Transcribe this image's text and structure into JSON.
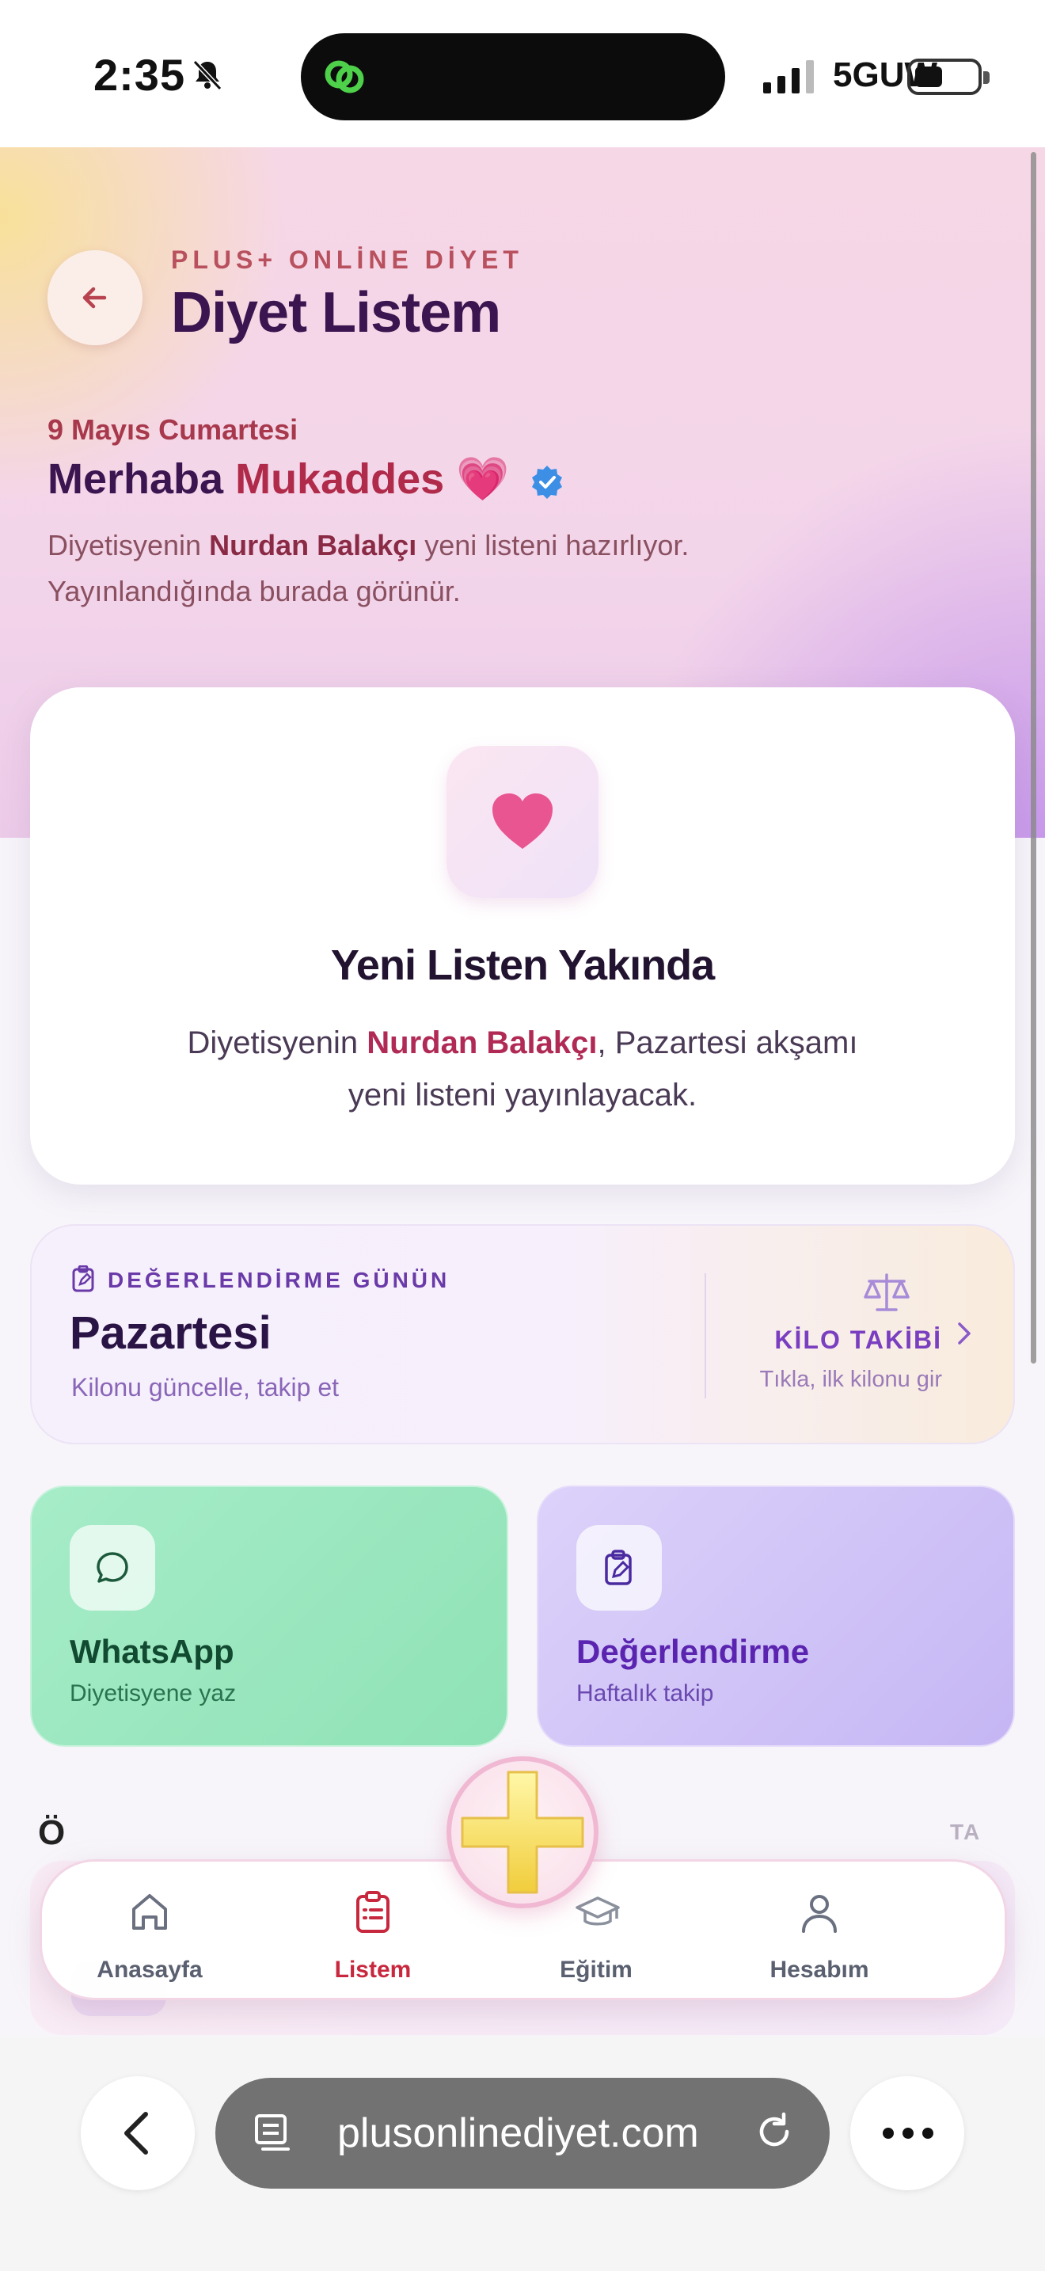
{
  "status_bar": {
    "time": "2:35",
    "network": "5GUW"
  },
  "header": {
    "brand": "PLUS+ ONLİNE DİYET",
    "title": "Diyet Listem"
  },
  "hero": {
    "date": "9 Mayıs Cumartesi",
    "greeting_prefix": "Merhaba",
    "user_name": "Mukaddes",
    "greeting_emoji": "💗",
    "info_prefix": "Diyetisyenin",
    "dietitian": "Nurdan Balakçı",
    "info_line1_suffix": "yeni listeni hazırlıyor.",
    "info_line2": "Yayınlandığında burada görünür."
  },
  "coming_soon": {
    "title": "Yeni Listen Yakında",
    "desc_prefix": "Diyetisyenin",
    "dietitian": "Nurdan Balakçı",
    "desc_line1_suffix": ", Pazartesi akşamı",
    "desc_line2": "yeni listeni yayınlayacak."
  },
  "evaluation": {
    "kicker": "DEĞERLENDİRME GÜNÜN",
    "day": "Pazartesi",
    "subtitle": "Kilonu güncelle, takip et",
    "weight_title": "KİLO TAKİBİ",
    "weight_subtitle": "Tıkla, ilk kilonu gir"
  },
  "tiles": {
    "whatsapp": {
      "title": "WhatsApp",
      "subtitle": "Diyetisyene yaz"
    },
    "review": {
      "title": "Değerlendirme",
      "subtitle": "Haftalık takip"
    }
  },
  "section_peek": {
    "title": "Ö",
    "right": "TA"
  },
  "bottom_nav": {
    "items": [
      {
        "label": "Anasayfa",
        "icon": "home-icon"
      },
      {
        "label": "Listem",
        "icon": "clipboard-list-icon",
        "active": true
      },
      {
        "label": "Eğitim",
        "icon": "graduation-cap-icon"
      },
      {
        "label": "Hesabım",
        "icon": "user-icon"
      }
    ]
  },
  "browser": {
    "url": "plusonlinediyet.com"
  },
  "colors": {
    "accent": "#b02a4a",
    "purple": "#3a1550",
    "active_nav": "#c8283e"
  }
}
